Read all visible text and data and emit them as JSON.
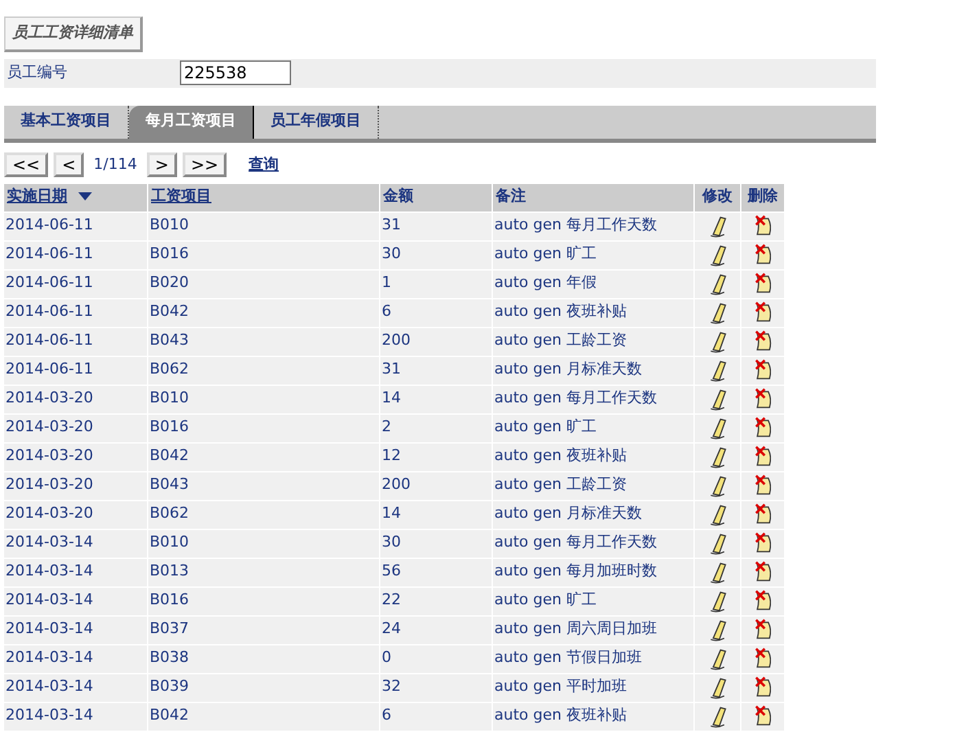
{
  "title_button": "员工工资详细清单",
  "employee": {
    "label": "员工编号",
    "value": "225538"
  },
  "tabs": [
    {
      "label": "基本工资项目",
      "selected": false
    },
    {
      "label": "每月工资项目",
      "selected": true
    },
    {
      "label": "员工年假项目",
      "selected": false
    }
  ],
  "pager": {
    "first": "<<",
    "prev": "<",
    "page": "1/114",
    "next": ">",
    "last": ">>",
    "query": "查询"
  },
  "table": {
    "columns": [
      {
        "label": "实施日期",
        "link": true,
        "sorted": true
      },
      {
        "label": "工资项目",
        "link": true,
        "sorted": false
      },
      {
        "label": "金额",
        "link": false,
        "sorted": false
      },
      {
        "label": "备注",
        "link": false,
        "sorted": false
      },
      {
        "label": "修改",
        "link": false,
        "sorted": false
      },
      {
        "label": "删除",
        "link": false,
        "sorted": false
      }
    ],
    "rows": [
      [
        "2014-06-11",
        "B010",
        "31",
        "auto gen 每月工作天数"
      ],
      [
        "2014-06-11",
        "B016",
        "30",
        "auto gen 旷工"
      ],
      [
        "2014-06-11",
        "B020",
        "1",
        "auto gen 年假"
      ],
      [
        "2014-06-11",
        "B042",
        "6",
        "auto gen 夜班补贴"
      ],
      [
        "2014-06-11",
        "B043",
        "200",
        "auto gen 工龄工资"
      ],
      [
        "2014-06-11",
        "B062",
        "31",
        "auto gen 月标准天数"
      ],
      [
        "2014-03-20",
        "B010",
        "14",
        "auto gen 每月工作天数"
      ],
      [
        "2014-03-20",
        "B016",
        "2",
        "auto gen 旷工"
      ],
      [
        "2014-03-20",
        "B042",
        "12",
        "auto gen 夜班补贴"
      ],
      [
        "2014-03-20",
        "B043",
        "200",
        "auto gen 工龄工资"
      ],
      [
        "2014-03-20",
        "B062",
        "14",
        "auto gen 月标准天数"
      ],
      [
        "2014-03-14",
        "B010",
        "30",
        "auto gen 每月工作天数"
      ],
      [
        "2014-03-14",
        "B013",
        "56",
        "auto gen 每月加班时数"
      ],
      [
        "2014-03-14",
        "B016",
        "22",
        "auto gen 旷工"
      ],
      [
        "2014-03-14",
        "B037",
        "24",
        "auto gen 周六周日加班"
      ],
      [
        "2014-03-14",
        "B038",
        "0",
        "auto gen 节假日加班"
      ],
      [
        "2014-03-14",
        "B039",
        "32",
        "auto gen 平时加班"
      ],
      [
        "2014-03-14",
        "B042",
        "6",
        "auto gen 夜班补贴"
      ]
    ]
  }
}
